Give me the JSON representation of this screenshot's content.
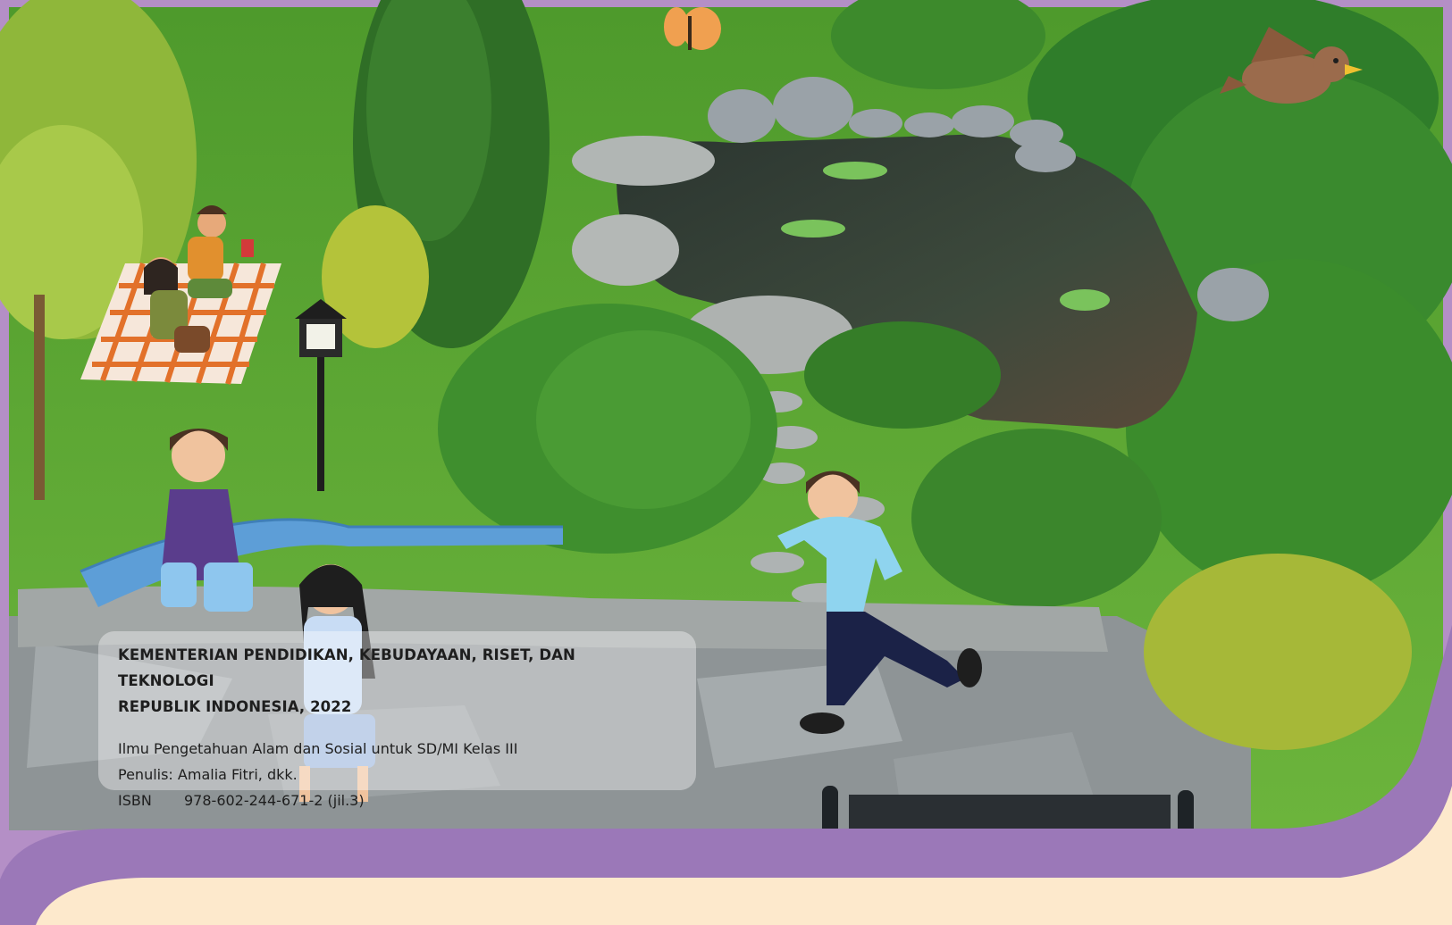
{
  "publisher": {
    "line1": "KEMENTERIAN PENDIDIKAN, KEBUDAYAAN, RISET, DAN TEKNOLOGI",
    "line2": "REPUBLIK INDONESIA, 2022"
  },
  "book": {
    "title": "Ilmu Pengetahuan Alam dan Sosial untuk SD/MI Kelas III",
    "author": "Penulis: Amalia Fitri, dkk.",
    "isbn_label": "ISBN",
    "isbn_value": "978-602-244-671-2  (jil.3)"
  },
  "colors": {
    "border_purple": "#b48fc6",
    "band_purple": "#9b78b8",
    "cream": "#fde9cc",
    "grass": "#5aa632",
    "bush": "#3f8a2a",
    "stone": "#9aa2a8",
    "pond": "#2f3a34"
  }
}
